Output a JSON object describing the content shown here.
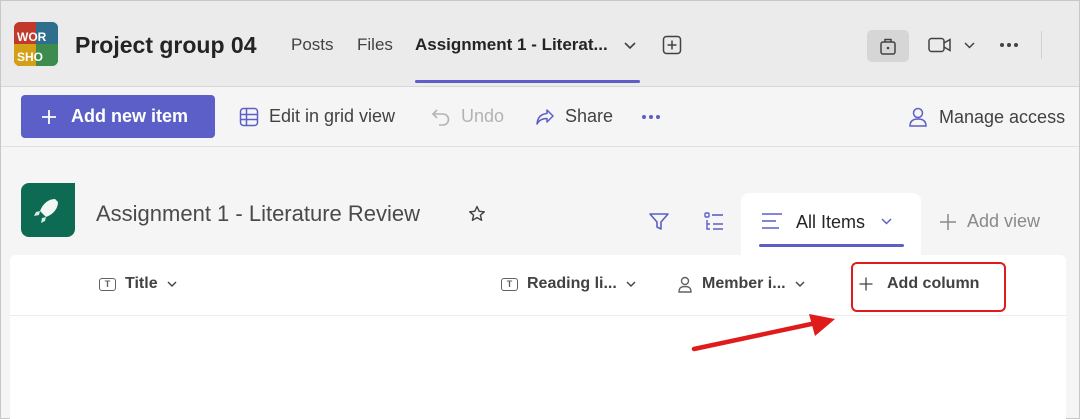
{
  "header": {
    "team_name": "Project group 04",
    "avatar_text_1": "WOR",
    "avatar_text_2": "SHO",
    "tabs": [
      {
        "label": "Posts"
      },
      {
        "label": "Files"
      },
      {
        "label": "Assignment 1 - Literat..."
      }
    ]
  },
  "commandbar": {
    "add_new_item": "Add new item",
    "edit_grid": "Edit in grid view",
    "undo": "Undo",
    "share": "Share",
    "manage_access": "Manage access"
  },
  "list": {
    "title": "Assignment 1 - Literature Review",
    "view_name": "All Items",
    "add_view": "Add view"
  },
  "columns": {
    "title": "Title",
    "reading_list": "Reading li...",
    "member": "Member i...",
    "add_column": "Add column",
    "type_glyph": "T"
  },
  "colors": {
    "accent": "#5b5fc7",
    "list_icon": "#0e6b53",
    "highlight": "#e01b1b"
  }
}
